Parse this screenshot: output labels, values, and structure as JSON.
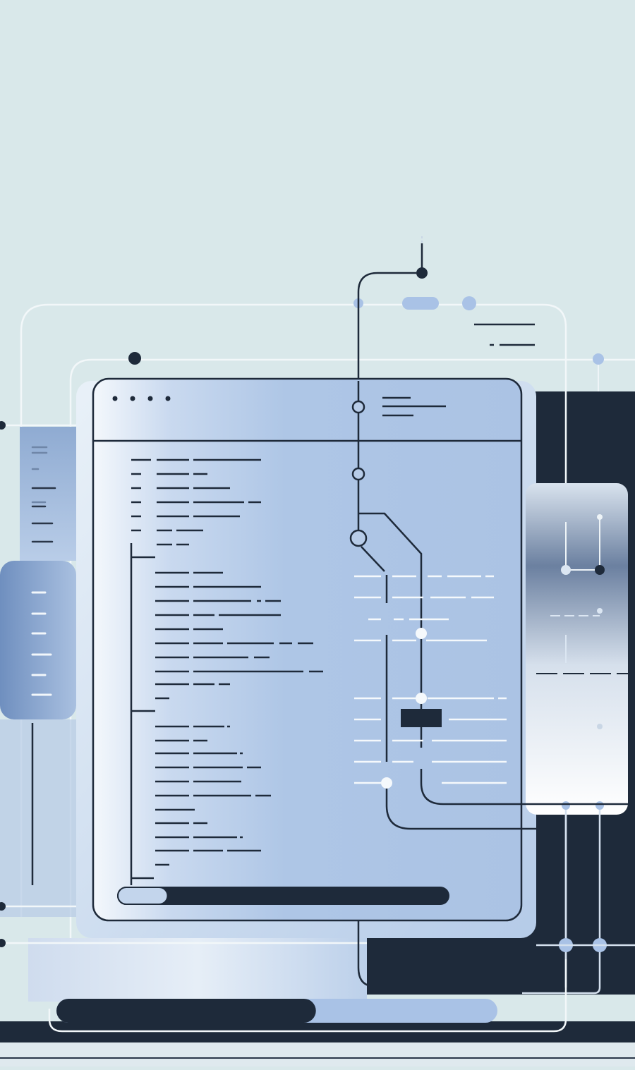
{
  "palette": {
    "background": "#d9e8ea",
    "panel_light": "#aec6e6",
    "panel_white": "#f3f7fb",
    "navy": "#1e2a3a",
    "wire_light": "#eef4f7",
    "accent_dot": "#a9c2e6"
  },
  "window": {
    "title_dots": 4,
    "progress": 0.12
  },
  "bottom_bar": {
    "progress": 0.55
  }
}
